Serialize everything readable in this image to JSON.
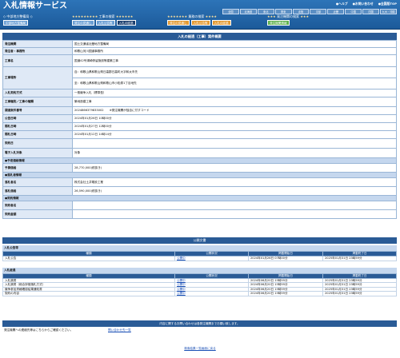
{
  "header": {
    "title": "入札情報サービス",
    "top_links": [
      "●ヘルプ",
      "●お問い合わせ",
      "●全国版TOP"
    ],
    "prefectures": [
      "全国",
      "北海道",
      "東北",
      "関東",
      "北陸",
      "中部",
      "近畿",
      "中国",
      "四国",
      "九州・沖縄"
    ],
    "nav_groups": [
      {
        "title": "工事の検索",
        "buttons": [
          "発注の見通し",
          "入札公告等",
          "入札の経過"
        ],
        "style": "blue"
      },
      {
        "title": "業務の検索",
        "buttons": [
          "発注の見通し",
          "入札公告等",
          "入札の経過"
        ],
        "style": "orange"
      },
      {
        "title": "発注機関の検索",
        "buttons": [
          "発注機関情報"
        ],
        "style": "green"
      }
    ],
    "left_label": "中部地方整備局",
    "left_sublabel": "中部地方整備局"
  },
  "summary": {
    "section_title": "入札の経過（工事）案件概要",
    "rows": [
      {
        "k": "発注機関",
        "v": "国土交通省近畿地方整備局"
      },
      {
        "k": "発注者・事務所",
        "v": "和歌山河川国道事務所"
      },
      {
        "k": "工事名",
        "v": "国道42号湯崎停留施設等建築工事"
      },
      {
        "k": "工事場所",
        "v": "自：和歌山県和歌山県日高郡日高町大字和太市先"
      },
      {
        "k": "",
        "v": "至：和歌山県和歌山県和歌山市小松原1丁目地先"
      },
      {
        "k": "入札契約方式",
        "v": "一般競争入札（標準型）"
      },
      {
        "k": "工事種別／工事の種類",
        "v": "築地造建工事"
      },
      {
        "k": "調達案件番号",
        "v": "2024866379833002　　※発注機関が独自に付すコード"
      },
      {
        "k": "公告日時",
        "v": "2024年01月26日 10時00分"
      },
      {
        "k": "開札日時",
        "v": "2024年01月27日 12時00分"
      },
      {
        "k": "開札日時",
        "v": "2024年01月12日 14時14分"
      },
      {
        "k": "契約日",
        "v": ""
      },
      {
        "k": "電子入札対象",
        "v": "対象"
      }
    ],
    "estimate_header": "●予定価格情報",
    "estimate": {
      "k": "予算価格",
      "v": "28,770,000(税抜き)"
    },
    "winner_header": "●落札者情報",
    "winner": [
      {
        "k": "落札者名",
        "v": "株式会社土井電設工業"
      },
      {
        "k": "落札価格",
        "v": "26,590,000(税抜き)"
      }
    ],
    "contract_header": "●契約情報",
    "contract": [
      {
        "k": "契約者名",
        "v": ""
      },
      {
        "k": "契約金額",
        "v": ""
      }
    ]
  },
  "documents": {
    "bar_title": "公開文書",
    "group1": {
      "title": "入札公告等",
      "headers": [
        "種類",
        "公開状況",
        "掲載開始日",
        "掲載終了日"
      ],
      "rows": [
        {
          "name": "入札公告",
          "status": "公開中",
          "start": "2024年01月26日 07時00分",
          "end": "2025年01月31日 23時59分"
        }
      ]
    },
    "group2": {
      "title": "入札経過",
      "headers": [
        "種類",
        "公開状況",
        "掲載開始日",
        "掲載終了日"
      ],
      "rows": [
        {
          "name": "入札調書",
          "status": "公開中",
          "start": "2024年06月20日 15時59分",
          "end": "2025年01月31日 23時59分"
        },
        {
          "name": "入札調書（総合評価落札方式）",
          "status": "公開中",
          "start": "2024年06月20日 15時59分",
          "end": "2025年01月31日 23時59分"
        },
        {
          "name": "競争参加資格確認結果通知書",
          "status": "公開中",
          "start": "2024年06月20日 15時59分",
          "end": "2025年01月31日 23時59分"
        },
        {
          "name": "契約の内容",
          "status": "公開中",
          "start": "2024年06月20日 15時59分",
          "end": "2025年01月31日 23時59分"
        }
      ]
    }
  },
  "contact": {
    "bar": "内容に関するお問い合わせは各発注機関までお願い致します。",
    "label": "発注機関への連絡先等はこちらからご確認ください。",
    "link": "問い合わせ先一覧"
  },
  "back_link": "検索結果一覧画面に戻る"
}
